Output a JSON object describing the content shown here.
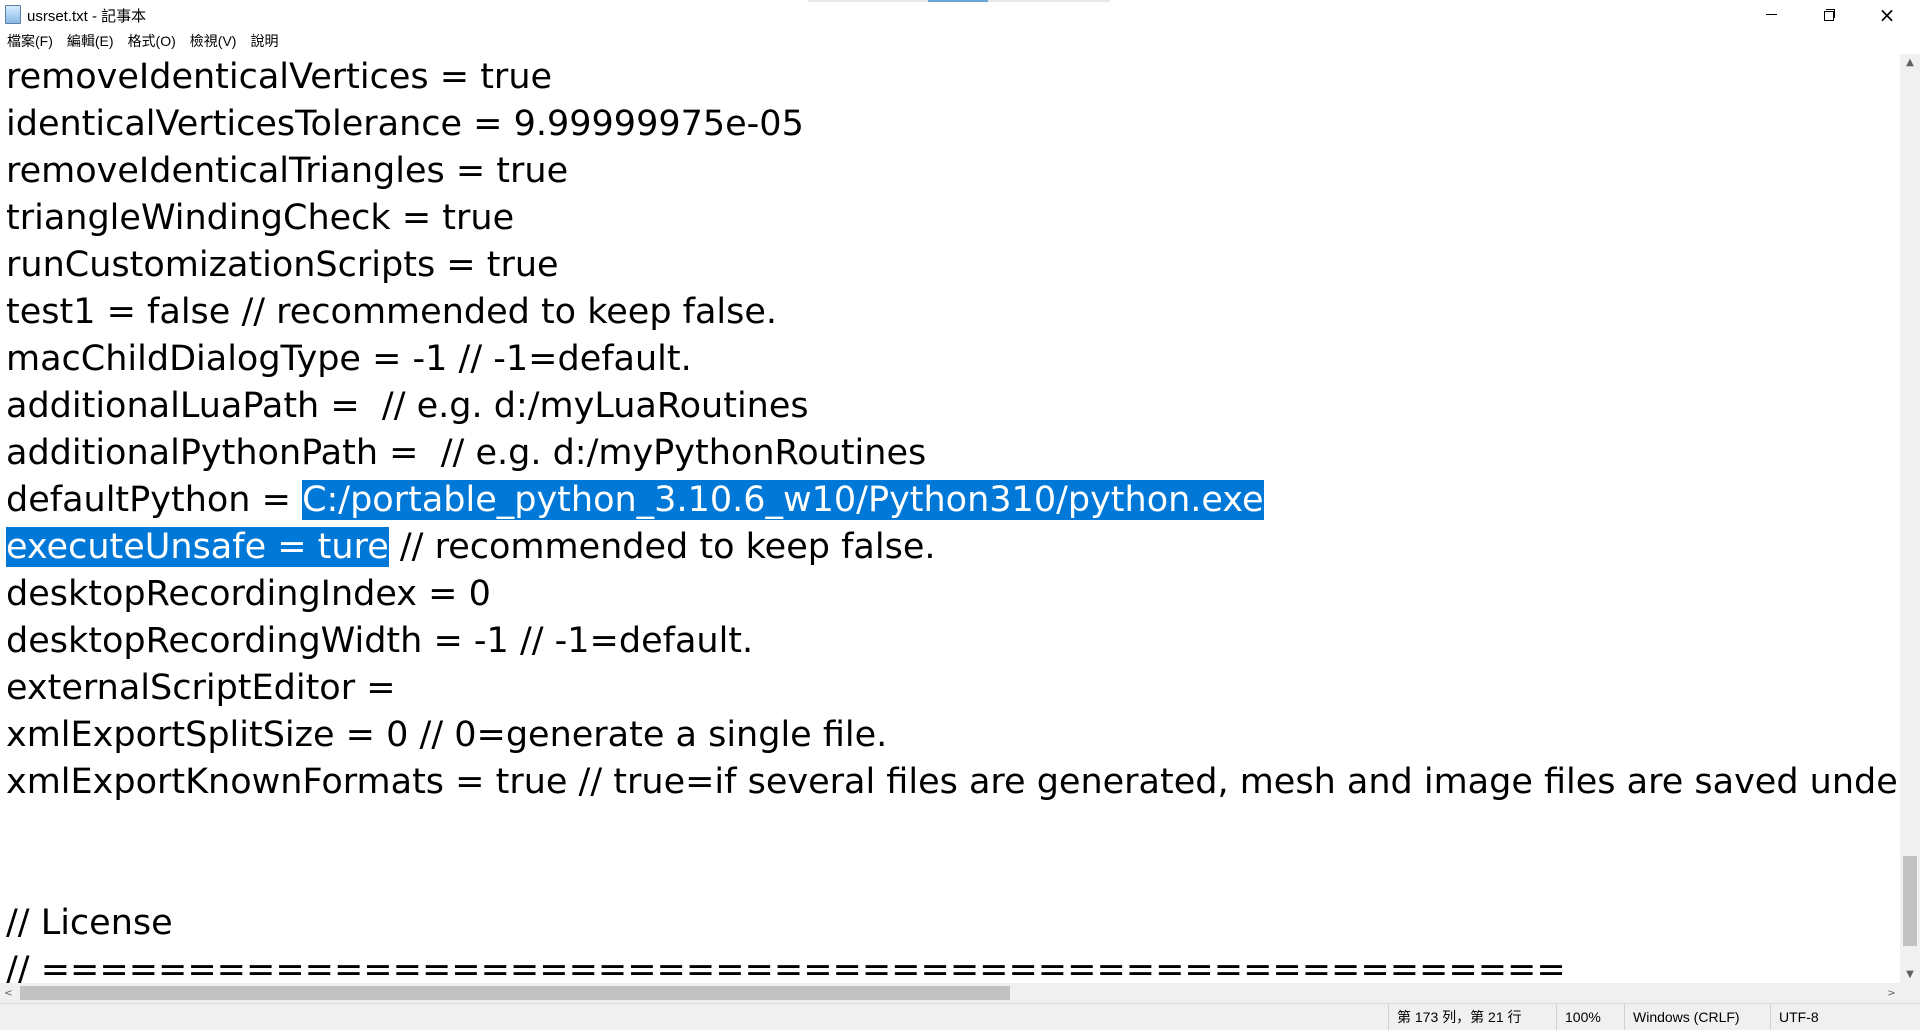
{
  "window": {
    "title": "usrset.txt - 記事本",
    "icon": "notepad-icon",
    "controls": {
      "minimize": "minimize-icon",
      "maximize": "restore-icon",
      "close": "×"
    }
  },
  "menu": [
    {
      "label": "檔案(F)"
    },
    {
      "label": "編輯(E)"
    },
    {
      "label": "格式(O)"
    },
    {
      "label": "檢視(V)"
    },
    {
      "label": "說明"
    }
  ],
  "editor": {
    "lines": [
      {
        "text": "removeIdenticalVertices = true"
      },
      {
        "text": "identicalVerticesTolerance = 9.99999975e-05"
      },
      {
        "text": "removeIdenticalTriangles = true"
      },
      {
        "text": "triangleWindingCheck = true"
      },
      {
        "text": "runCustomizationScripts = true"
      },
      {
        "text": "test1 = false // recommended to keep false."
      },
      {
        "text": "macChildDialogType = -1 // -1=default."
      },
      {
        "text": "additionalLuaPath =  // e.g. d:/myLuaRoutines"
      },
      {
        "text": "additionalPythonPath =  // e.g. d:/myPythonRoutines"
      },
      {
        "pre": "defaultPython = ",
        "selected": "C:/portable_python_3.10.6_w10/Python310/python.exe"
      },
      {
        "selected": "executeUnsafe = ture",
        "post": " // recommended to keep false."
      },
      {
        "text": "desktopRecordingIndex = 0"
      },
      {
        "text": "desktopRecordingWidth = -1 // -1=default."
      },
      {
        "text": "externalScriptEditor = "
      },
      {
        "text": "xmlExportSplitSize = 0 // 0=generate a single file."
      },
      {
        "text": "xmlExportKnownFormats = true // true=if several files are generated, mesh and image files are saved under known"
      },
      {
        "text": ""
      },
      {
        "text": ""
      },
      {
        "text": "// License"
      },
      {
        "text": "// ===================================================="
      }
    ],
    "selection_color": "#0078d7"
  },
  "scrollbars": {
    "up_arrow": "▲",
    "down_arrow": "▼",
    "left_arrow": "<",
    "right_arrow": ">"
  },
  "status": {
    "position": "第 173 列，第 21 行",
    "zoom": "100%",
    "line_ending": "Windows (CRLF)",
    "encoding": "UTF-8"
  }
}
